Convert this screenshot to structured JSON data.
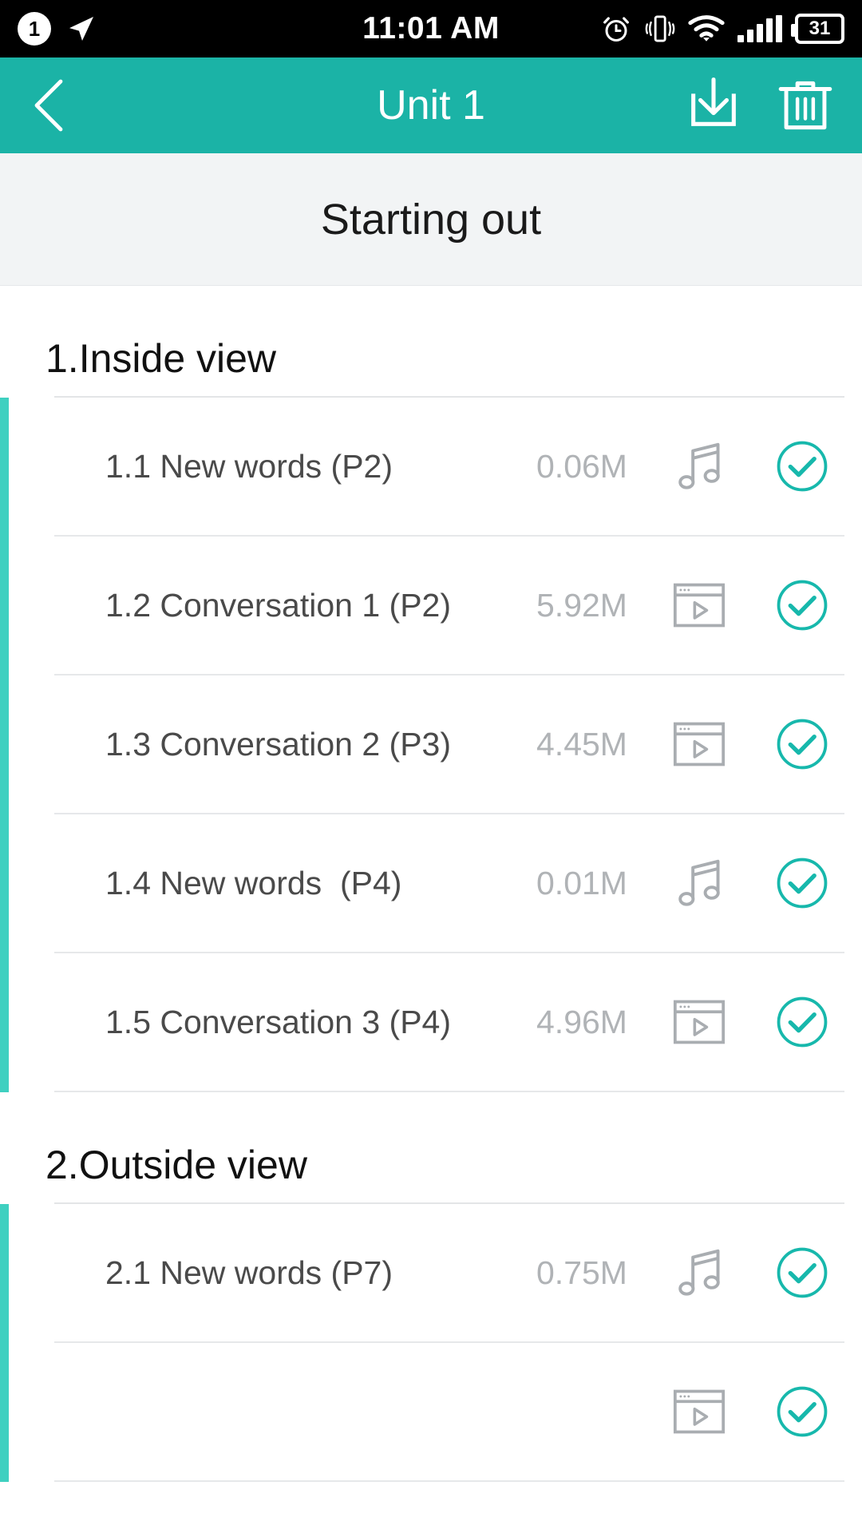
{
  "status_bar": {
    "time": "11:01 AM",
    "notification_badge": "1",
    "battery_level": "31",
    "icons": [
      "notification-badge-icon",
      "location-arrow-icon",
      "alarm-clock-icon",
      "vibrate-icon",
      "wifi-icon",
      "signal-bars-icon",
      "battery-icon"
    ]
  },
  "app_bar": {
    "title": "Unit 1",
    "back_label": "Back",
    "download_label": "Download",
    "delete_label": "Delete"
  },
  "sub_header": {
    "title": "Starting out"
  },
  "sections": [
    {
      "title": "1.Inside view",
      "rows": [
        {
          "title": "1.1 New words (P2)",
          "size": "0.06M",
          "media": "audio",
          "state": "downloaded"
        },
        {
          "title": "1.2 Conversation 1 (P2)",
          "size": "5.92M",
          "media": "video",
          "state": "downloaded"
        },
        {
          "title": "1.3 Conversation 2 (P3)",
          "size": "4.45M",
          "media": "video",
          "state": "downloaded"
        },
        {
          "title": "1.4 New words  (P4)",
          "size": "0.01M",
          "media": "audio",
          "state": "downloaded"
        },
        {
          "title": "1.5 Conversation 3 (P4)",
          "size": "4.96M",
          "media": "video",
          "state": "downloaded"
        }
      ]
    },
    {
      "title": "2.Outside view",
      "rows": [
        {
          "title": "2.1 New words (P7)",
          "size": "0.75M",
          "media": "audio",
          "state": "downloaded"
        },
        {
          "title": "",
          "size": "",
          "media": "video",
          "state": "downloaded"
        }
      ]
    }
  ],
  "colors": {
    "brand_teal": "#1bb3a6",
    "accent_teal": "#3fd0c0",
    "check_teal": "#17b8ac",
    "subheader_bg": "#f2f4f5",
    "muted_text": "#b0b3b6",
    "row_text": "#4a4a4a"
  }
}
